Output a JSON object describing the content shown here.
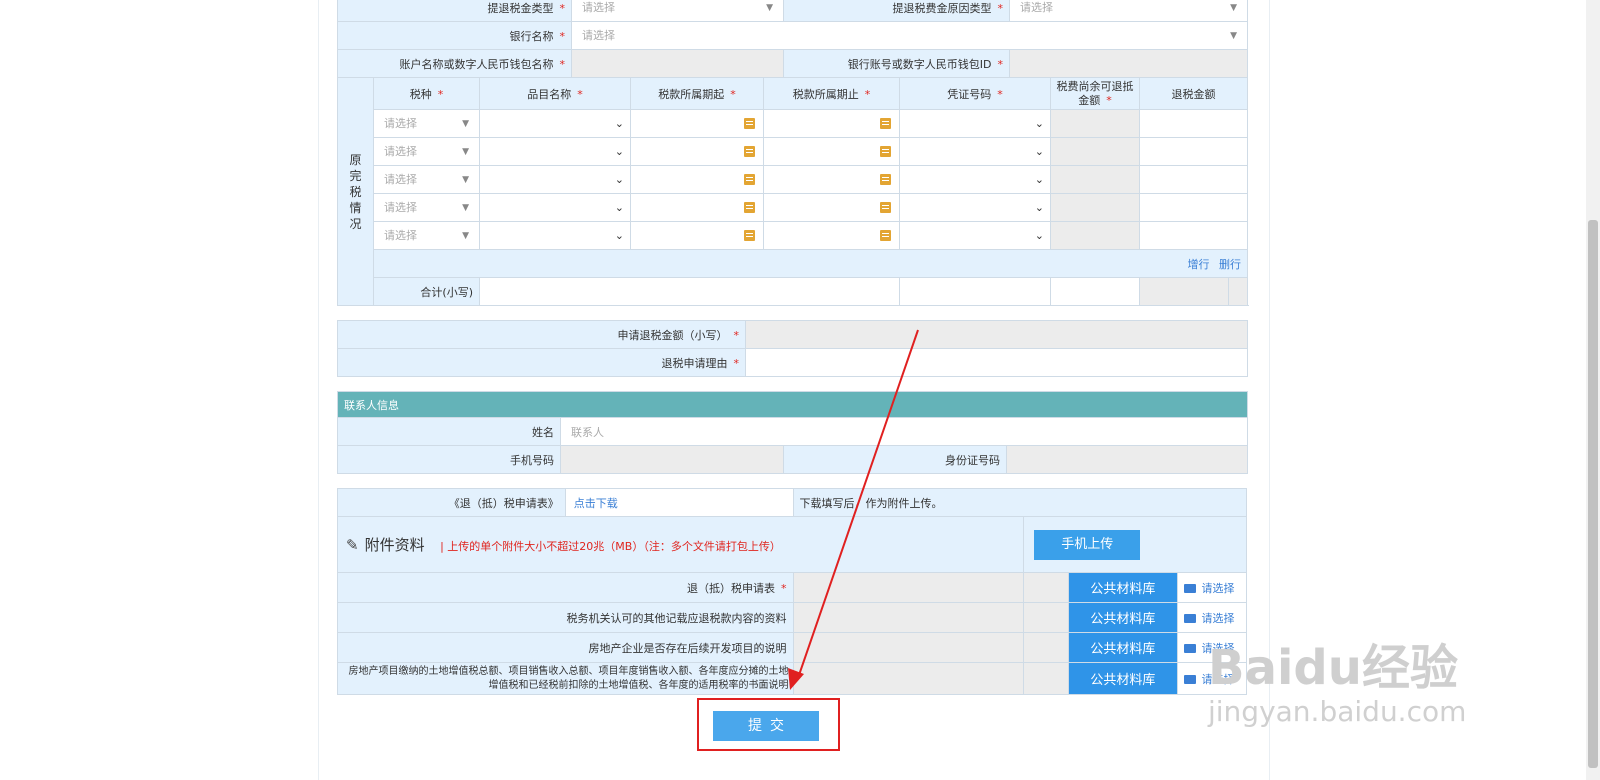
{
  "top": {
    "refund_tax_type_label": "提退税金类型",
    "refund_tax_type_value": "请选择",
    "refund_reason_type_label": "提退税费金原因类型",
    "refund_reason_type_value": "请选择",
    "bank_name_label": "银行名称",
    "bank_name_value": "请选择",
    "account_name_label": "账户名称或数字人民币钱包名称",
    "account_no_label": "银行账号或数字人民币钱包ID",
    "required_mark": "*"
  },
  "grid": {
    "section_label": "原完税情况",
    "headers": {
      "tax_type": "税种",
      "item_name": "品目名称",
      "period_start": "税款所属期起",
      "period_end": "税款所属期止",
      "voucher_no": "凭证号码",
      "remaining": "税费尚余可退抵金额",
      "refund_amount": "退税金额"
    },
    "row_placeholder": "请选择",
    "add_row": "增行",
    "delete_row": "删行",
    "total_label": "合计(小写)"
  },
  "apply": {
    "amount_label": "申请退税金额（小写）",
    "reason_label": "退税申请理由"
  },
  "contact": {
    "section_title": "联系人信息",
    "name_label": "姓名",
    "name_placeholder": "联系人",
    "phone_label": "手机号码",
    "id_label": "身份证号码"
  },
  "attachments": {
    "form_label": "《退（抵）税申请表》",
    "download_link": "点击下载",
    "download_note": "下载填写后，作为附件上传。",
    "title": "附件资料",
    "note": "| 上传的单个附件大小不超过20兆（MB）（注：多个文件请打包上传）",
    "mobile_upload": "手机上传",
    "public_library": "公共材料库",
    "choose": "请选择",
    "items": [
      "退（抵）税申请表",
      "税务机关认可的其他记载应退税款内容的资料",
      "房地产企业是否存在后续开发项目的说明",
      "房地产项目缴纳的土地增值税总额、项目销售收入总额、项目年度销售收入额、各年度应分摊的土地增值税和已经税前扣除的土地增值税、各年度的适用税率的书面说明"
    ]
  },
  "submit_label": "提交",
  "watermark": {
    "main": "Baidu经验",
    "sub": "jingyan.baidu.com"
  }
}
